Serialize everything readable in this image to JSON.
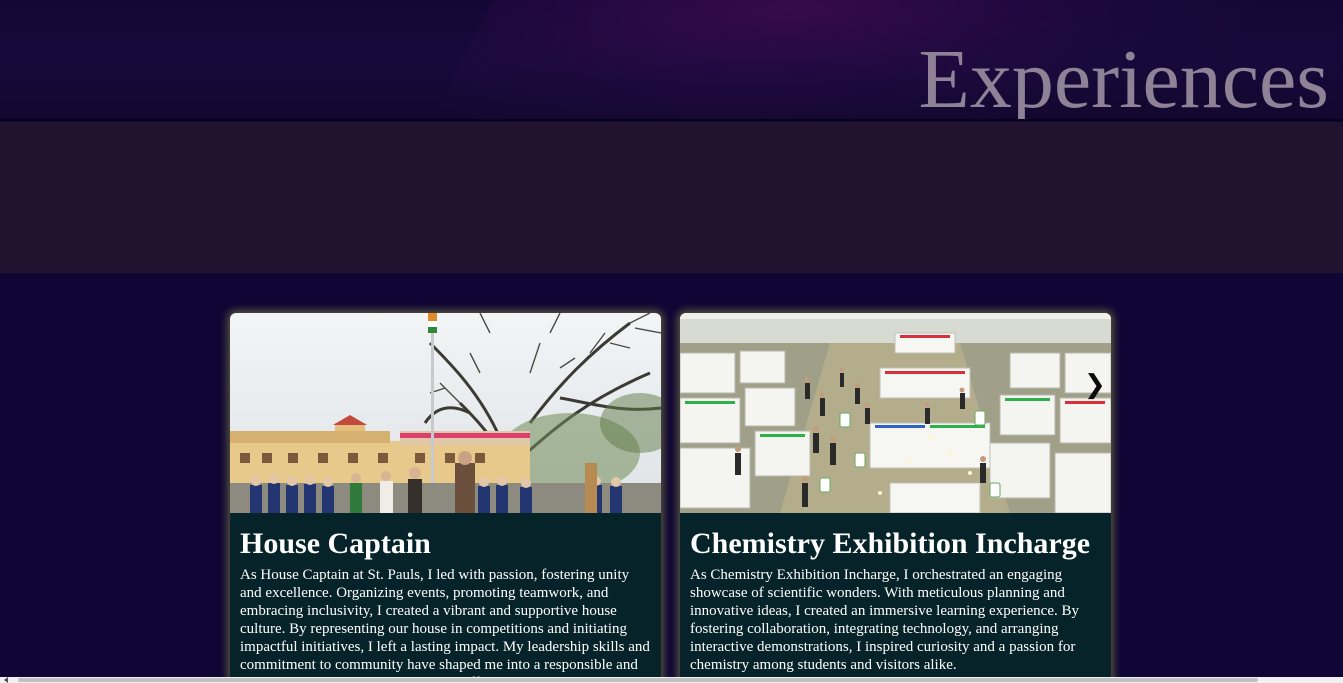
{
  "hero": {
    "title": "Experiences"
  },
  "cards": [
    {
      "title": "House Captain",
      "text": "As House Captain at St. Pauls, I led with passion, fostering unity and excellence. Organizing events, promoting teamwork, and embracing inclusivity, I created a vibrant and supportive house culture. By representing our house in competitions and initiating impactful initiatives, I left a lasting impact. My leadership skills and commitment to community have shaped me into a responsible and empowering leader ready to make a difference.",
      "image": "school-assembly-photo"
    },
    {
      "title": "Chemistry Exhibition Incharge",
      "text": "As Chemistry Exhibition Incharge, I orchestrated an engaging showcase of scientific wonders. With meticulous planning and innovative ideas, I created an immersive learning experience. By fostering collaboration, integrating technology, and arranging interactive demonstrations, I inspired curiosity and a passion for chemistry among students and visitors alike.",
      "image": "exhibition-hall-photo"
    }
  ],
  "carousel": {
    "next_icon": "chevron-right-icon",
    "next_glyph": "❯"
  },
  "colors": {
    "background": "#0f0635",
    "hero": "#170939",
    "band": "#21122f",
    "card": "#06232a",
    "card_glow": "#d6e050",
    "title_text": "#8f8297"
  }
}
